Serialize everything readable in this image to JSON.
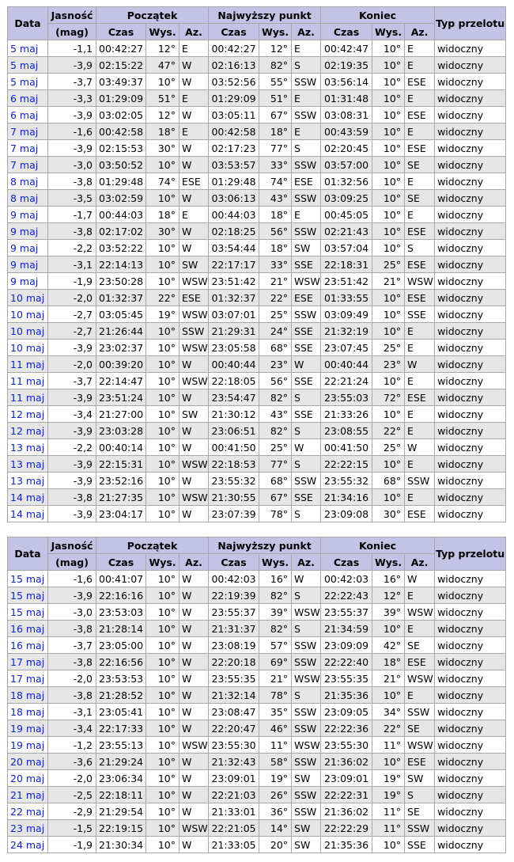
{
  "headers": {
    "data": "Data",
    "brightness_top": "Jasność",
    "brightness_unit": "(mag)",
    "start": "Początek",
    "peak": "Najwyższy punkt",
    "end": "Koniec",
    "pass_type": "Typ przelotu",
    "time": "Czas",
    "alt": "Wys.",
    "az": "Az."
  },
  "table1": [
    [
      "5 maj",
      "-1,1",
      "00:42:27",
      "12°",
      "E",
      "00:42:27",
      "12°",
      "E",
      "00:42:47",
      "10°",
      "E",
      "widoczny"
    ],
    [
      "5 maj",
      "-3,9",
      "02:15:22",
      "47°",
      "W",
      "02:16:13",
      "82°",
      "S",
      "02:19:35",
      "10°",
      "E",
      "widoczny"
    ],
    [
      "5 maj",
      "-3,7",
      "03:49:37",
      "10°",
      "W",
      "03:52:56",
      "55°",
      "SSW",
      "03:56:14",
      "10°",
      "ESE",
      "widoczny"
    ],
    [
      "6 maj",
      "-3,3",
      "01:29:09",
      "51°",
      "E",
      "01:29:09",
      "51°",
      "E",
      "01:31:48",
      "10°",
      "E",
      "widoczny"
    ],
    [
      "6 maj",
      "-3,9",
      "03:02:05",
      "12°",
      "W",
      "03:05:11",
      "67°",
      "SSW",
      "03:08:31",
      "10°",
      "ESE",
      "widoczny"
    ],
    [
      "7 maj",
      "-1,6",
      "00:42:58",
      "18°",
      "E",
      "00:42:58",
      "18°",
      "E",
      "00:43:59",
      "10°",
      "E",
      "widoczny"
    ],
    [
      "7 maj",
      "-3,9",
      "02:15:53",
      "30°",
      "W",
      "02:17:23",
      "77°",
      "S",
      "02:20:45",
      "10°",
      "ESE",
      "widoczny"
    ],
    [
      "7 maj",
      "-3,0",
      "03:50:52",
      "10°",
      "W",
      "03:53:57",
      "33°",
      "SSW",
      "03:57:00",
      "10°",
      "SE",
      "widoczny"
    ],
    [
      "8 maj",
      "-3,8",
      "01:29:48",
      "74°",
      "ESE",
      "01:29:48",
      "74°",
      "ESE",
      "01:32:56",
      "10°",
      "E",
      "widoczny"
    ],
    [
      "8 maj",
      "-3,5",
      "03:02:59",
      "10°",
      "W",
      "03:06:13",
      "43°",
      "SSW",
      "03:09:25",
      "10°",
      "SE",
      "widoczny"
    ],
    [
      "9 maj",
      "-1,7",
      "00:44:03",
      "18°",
      "E",
      "00:44:03",
      "18°",
      "E",
      "00:45:05",
      "10°",
      "E",
      "widoczny"
    ],
    [
      "9 maj",
      "-3,8",
      "02:17:02",
      "30°",
      "W",
      "02:18:25",
      "56°",
      "SSW",
      "02:21:43",
      "10°",
      "ESE",
      "widoczny"
    ],
    [
      "9 maj",
      "-2,2",
      "03:52:22",
      "10°",
      "W",
      "03:54:44",
      "18°",
      "SW",
      "03:57:04",
      "10°",
      "S",
      "widoczny"
    ],
    [
      "9 maj",
      "-3,1",
      "22:14:13",
      "10°",
      "SW",
      "22:17:17",
      "33°",
      "SSE",
      "22:18:31",
      "25°",
      "ESE",
      "widoczny"
    ],
    [
      "9 maj",
      "-1,9",
      "23:50:28",
      "10°",
      "WSW",
      "23:51:42",
      "21°",
      "WSW",
      "23:51:42",
      "21°",
      "WSW",
      "widoczny"
    ],
    [
      "10 maj",
      "-2,0",
      "01:32:37",
      "22°",
      "ESE",
      "01:32:37",
      "22°",
      "ESE",
      "01:33:55",
      "10°",
      "ESE",
      "widoczny"
    ],
    [
      "10 maj",
      "-2,7",
      "03:05:45",
      "19°",
      "WSW",
      "03:07:01",
      "25°",
      "SSW",
      "03:09:49",
      "10°",
      "SSE",
      "widoczny"
    ],
    [
      "10 maj",
      "-2,7",
      "21:26:44",
      "10°",
      "SSW",
      "21:29:31",
      "24°",
      "SSE",
      "21:32:19",
      "10°",
      "E",
      "widoczny"
    ],
    [
      "10 maj",
      "-3,9",
      "23:02:37",
      "10°",
      "WSW",
      "23:05:58",
      "68°",
      "SSE",
      "23:07:45",
      "25°",
      "E",
      "widoczny"
    ],
    [
      "11 maj",
      "-2,0",
      "00:39:20",
      "10°",
      "W",
      "00:40:44",
      "23°",
      "W",
      "00:40:44",
      "23°",
      "W",
      "widoczny"
    ],
    [
      "11 maj",
      "-3,7",
      "22:14:47",
      "10°",
      "WSW",
      "22:18:05",
      "56°",
      "SSE",
      "22:21:24",
      "10°",
      "E",
      "widoczny"
    ],
    [
      "11 maj",
      "-3,9",
      "23:51:24",
      "10°",
      "W",
      "23:54:47",
      "82°",
      "S",
      "23:55:03",
      "72°",
      "ESE",
      "widoczny"
    ],
    [
      "12 maj",
      "-3,4",
      "21:27:00",
      "10°",
      "SW",
      "21:30:12",
      "43°",
      "SSE",
      "21:33:26",
      "10°",
      "E",
      "widoczny"
    ],
    [
      "12 maj",
      "-3,9",
      "23:03:28",
      "10°",
      "W",
      "23:06:51",
      "82°",
      "S",
      "23:08:55",
      "22°",
      "E",
      "widoczny"
    ],
    [
      "13 maj",
      "-2,2",
      "00:40:14",
      "10°",
      "W",
      "00:41:50",
      "25°",
      "W",
      "00:41:50",
      "25°",
      "W",
      "widoczny"
    ],
    [
      "13 maj",
      "-3,9",
      "22:15:31",
      "10°",
      "WSW",
      "22:18:53",
      "77°",
      "S",
      "22:22:15",
      "10°",
      "E",
      "widoczny"
    ],
    [
      "13 maj",
      "-3,9",
      "23:52:16",
      "10°",
      "W",
      "23:55:32",
      "68°",
      "SSW",
      "23:55:32",
      "68°",
      "SSW",
      "widoczny"
    ],
    [
      "14 maj",
      "-3,8",
      "21:27:35",
      "10°",
      "WSW",
      "21:30:55",
      "67°",
      "SSE",
      "21:34:16",
      "10°",
      "E",
      "widoczny"
    ],
    [
      "14 maj",
      "-3,9",
      "23:04:17",
      "10°",
      "W",
      "23:07:39",
      "78°",
      "S",
      "23:09:08",
      "30°",
      "ESE",
      "widoczny"
    ]
  ],
  "table2": [
    [
      "15 maj",
      "-1,6",
      "00:41:07",
      "10°",
      "W",
      "00:42:03",
      "16°",
      "W",
      "00:42:03",
      "16°",
      "W",
      "widoczny"
    ],
    [
      "15 maj",
      "-3,9",
      "22:16:16",
      "10°",
      "W",
      "22:19:39",
      "82°",
      "S",
      "22:22:43",
      "12°",
      "E",
      "widoczny"
    ],
    [
      "15 maj",
      "-3,0",
      "23:53:03",
      "10°",
      "W",
      "23:55:37",
      "39°",
      "WSW",
      "23:55:37",
      "39°",
      "WSW",
      "widoczny"
    ],
    [
      "16 maj",
      "-3,8",
      "21:28:14",
      "10°",
      "W",
      "21:31:37",
      "82°",
      "S",
      "21:34:59",
      "10°",
      "E",
      "widoczny"
    ],
    [
      "16 maj",
      "-3,7",
      "23:05:00",
      "10°",
      "W",
      "23:08:19",
      "57°",
      "SSW",
      "23:09:09",
      "42°",
      "SE",
      "widoczny"
    ],
    [
      "17 maj",
      "-3,8",
      "22:16:56",
      "10°",
      "W",
      "22:20:18",
      "69°",
      "SSW",
      "22:22:40",
      "18°",
      "ESE",
      "widoczny"
    ],
    [
      "17 maj",
      "-2,0",
      "23:53:53",
      "10°",
      "W",
      "23:55:35",
      "21°",
      "WSW",
      "23:55:35",
      "21°",
      "WSW",
      "widoczny"
    ],
    [
      "18 maj",
      "-3,8",
      "21:28:52",
      "10°",
      "W",
      "21:32:14",
      "78°",
      "S",
      "21:35:36",
      "10°",
      "E",
      "widoczny"
    ],
    [
      "18 maj",
      "-3,1",
      "23:05:41",
      "10°",
      "W",
      "23:08:47",
      "35°",
      "SSW",
      "23:09:05",
      "34°",
      "SSW",
      "widoczny"
    ],
    [
      "19 maj",
      "-3,4",
      "22:17:33",
      "10°",
      "W",
      "22:20:47",
      "46°",
      "SSW",
      "22:22:36",
      "22°",
      "SE",
      "widoczny"
    ],
    [
      "19 maj",
      "-1,2",
      "23:55:13",
      "10°",
      "WSW",
      "23:55:30",
      "11°",
      "WSW",
      "23:55:30",
      "11°",
      "WSW",
      "widoczny"
    ],
    [
      "20 maj",
      "-3,6",
      "21:29:24",
      "10°",
      "W",
      "21:32:43",
      "58°",
      "SSW",
      "21:36:02",
      "10°",
      "ESE",
      "widoczny"
    ],
    [
      "20 maj",
      "-2,0",
      "23:06:34",
      "10°",
      "W",
      "23:09:01",
      "19°",
      "SW",
      "23:09:01",
      "19°",
      "SW",
      "widoczny"
    ],
    [
      "21 maj",
      "-2,5",
      "22:18:11",
      "10°",
      "W",
      "22:21:03",
      "26°",
      "SSW",
      "22:22:31",
      "19°",
      "S",
      "widoczny"
    ],
    [
      "22 maj",
      "-2,9",
      "21:29:54",
      "10°",
      "W",
      "21:33:01",
      "36°",
      "SSW",
      "21:36:02",
      "11°",
      "SE",
      "widoczny"
    ],
    [
      "23 maj",
      "-1,5",
      "22:19:15",
      "10°",
      "WSW",
      "22:21:05",
      "14°",
      "SW",
      "22:22:29",
      "11°",
      "SSW",
      "widoczny"
    ],
    [
      "24 maj",
      "-1,9",
      "21:30:34",
      "10°",
      "W",
      "21:33:05",
      "20°",
      "SW",
      "21:35:36",
      "10°",
      "SSE",
      "widoczny"
    ]
  ]
}
